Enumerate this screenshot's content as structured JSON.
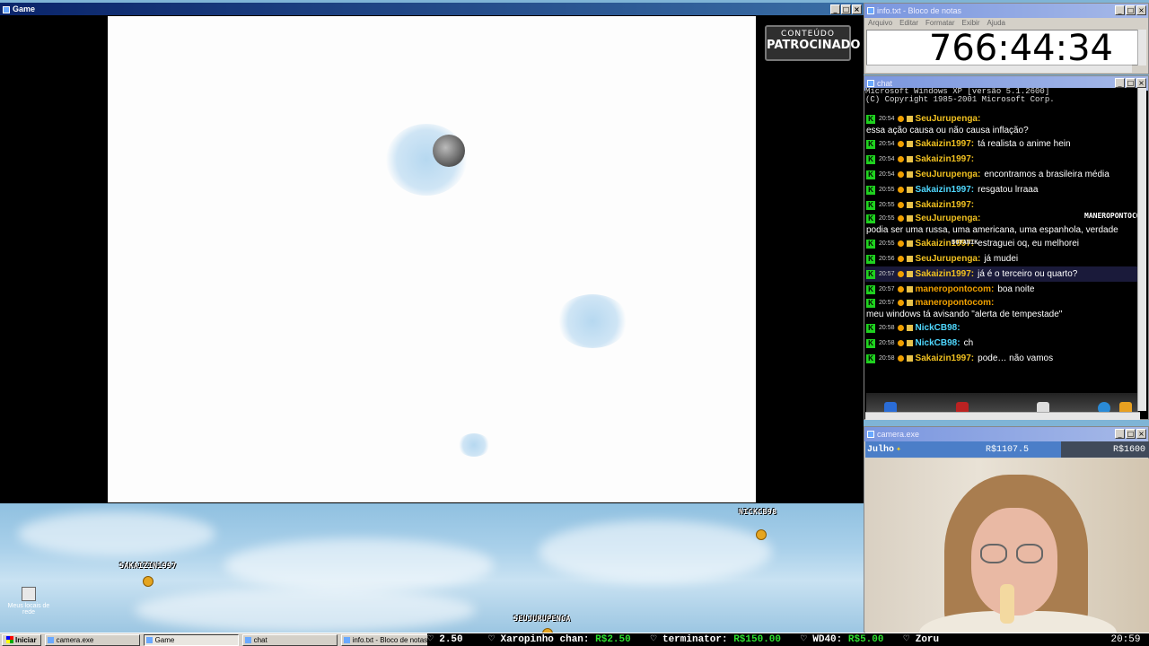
{
  "game_window": {
    "title": "Game",
    "sponsor_line1": "CONTEÚDO",
    "sponsor_line2": "PATROCINADO"
  },
  "notepad": {
    "title": "info.txt - Bloco de notas",
    "menu": [
      "Arquivo",
      "Editar",
      "Formatar",
      "Exibir",
      "Ajuda"
    ],
    "timer": "766:44:34"
  },
  "chat_window": {
    "title": "chat",
    "console_line1": "Microsoft Windows XP [versão 5.1.2600]",
    "console_line2": "(C) Copyright 1985-2001 Microsoft Corp.",
    "messages": [
      {
        "time": "20:54",
        "user": "SeuJurupenga:",
        "text": "essa ação causa ou não causa inflação?",
        "color": "#f0c020"
      },
      {
        "time": "20:54",
        "user": "Sakaizin1997:",
        "text": "tá realista o anime hein",
        "color": "#f0c020"
      },
      {
        "time": "20:54",
        "user": "Sakaizin1997:",
        "text": "",
        "color": "#f0c020"
      },
      {
        "time": "20:54",
        "user": "SeuJurupenga:",
        "text": "encontramos a brasileira média",
        "color": "#f0c020"
      },
      {
        "time": "20:55",
        "user": "Sakaizin1997:",
        "text": "resgatou lrraaa",
        "color": "#4fd8ff"
      },
      {
        "time": "20:55",
        "user": "Sakaizin1997:",
        "text": "",
        "color": "#f0c020"
      },
      {
        "time": "20:55",
        "user": "SeuJurupenga:",
        "text": "podia ser uma russa, uma americana, uma espanhola, verdade",
        "color": "#f0c020"
      },
      {
        "time": "20:55",
        "user": "Sakaizin1997:",
        "text": "estraguei oq, eu melhorei",
        "color": "#f0c020"
      },
      {
        "time": "20:56",
        "user": "SeuJurupenga:",
        "text": "já mudei",
        "color": "#f0c020"
      },
      {
        "time": "20:57",
        "user": "Sakaizin1997:",
        "text": "já é o terceiro ou quarto?",
        "color": "#f0c020"
      },
      {
        "time": "20:57",
        "user": "maneropontocom:",
        "text": "boa noite",
        "color": "#f0a000"
      },
      {
        "time": "20:57",
        "user": "maneropontocom:",
        "text": "meu windows tá avisando \"alerta de tempestade\"",
        "color": "#f0a000"
      },
      {
        "time": "20:58",
        "user": "NickCB98:",
        "text": "",
        "color": "#4fd8ff"
      },
      {
        "time": "20:58",
        "user": "NickCB98:",
        "text": "ch",
        "color": "#4fd8ff"
      },
      {
        "time": "20:58",
        "user": "Sakaizin1997:",
        "text": "pode… não vamos",
        "color": "#f0c020"
      }
    ],
    "overlay_label": "MANEROPONTOCOM",
    "botanik_label": "BOTANIK"
  },
  "camera_window": {
    "title": "camera.exe",
    "month": "Julho",
    "current": "R$1107.5",
    "goal": "R$1600",
    "progress": 0.69
  },
  "desktop": {
    "icon_label": "Meus locais de rede",
    "players": [
      "NICKCB98",
      "SAKAIZIN1997",
      "SEUJURUPENGA"
    ]
  },
  "taskbar": {
    "start": "Iniciar",
    "tasks": [
      "camera.exe",
      "Game",
      "chat",
      "info.txt - Bloco de notas"
    ],
    "ticker": [
      {
        "label": "2.50",
        "amount": ""
      },
      {
        "label": "Xaropinho chan:",
        "amount": "R$2.50"
      },
      {
        "label": "terminator:",
        "amount": "R$150.00"
      },
      {
        "label": "WD40:",
        "amount": "R$5.00"
      },
      {
        "label": "Zoru",
        "amount": ""
      }
    ],
    "clock": "20:59"
  }
}
